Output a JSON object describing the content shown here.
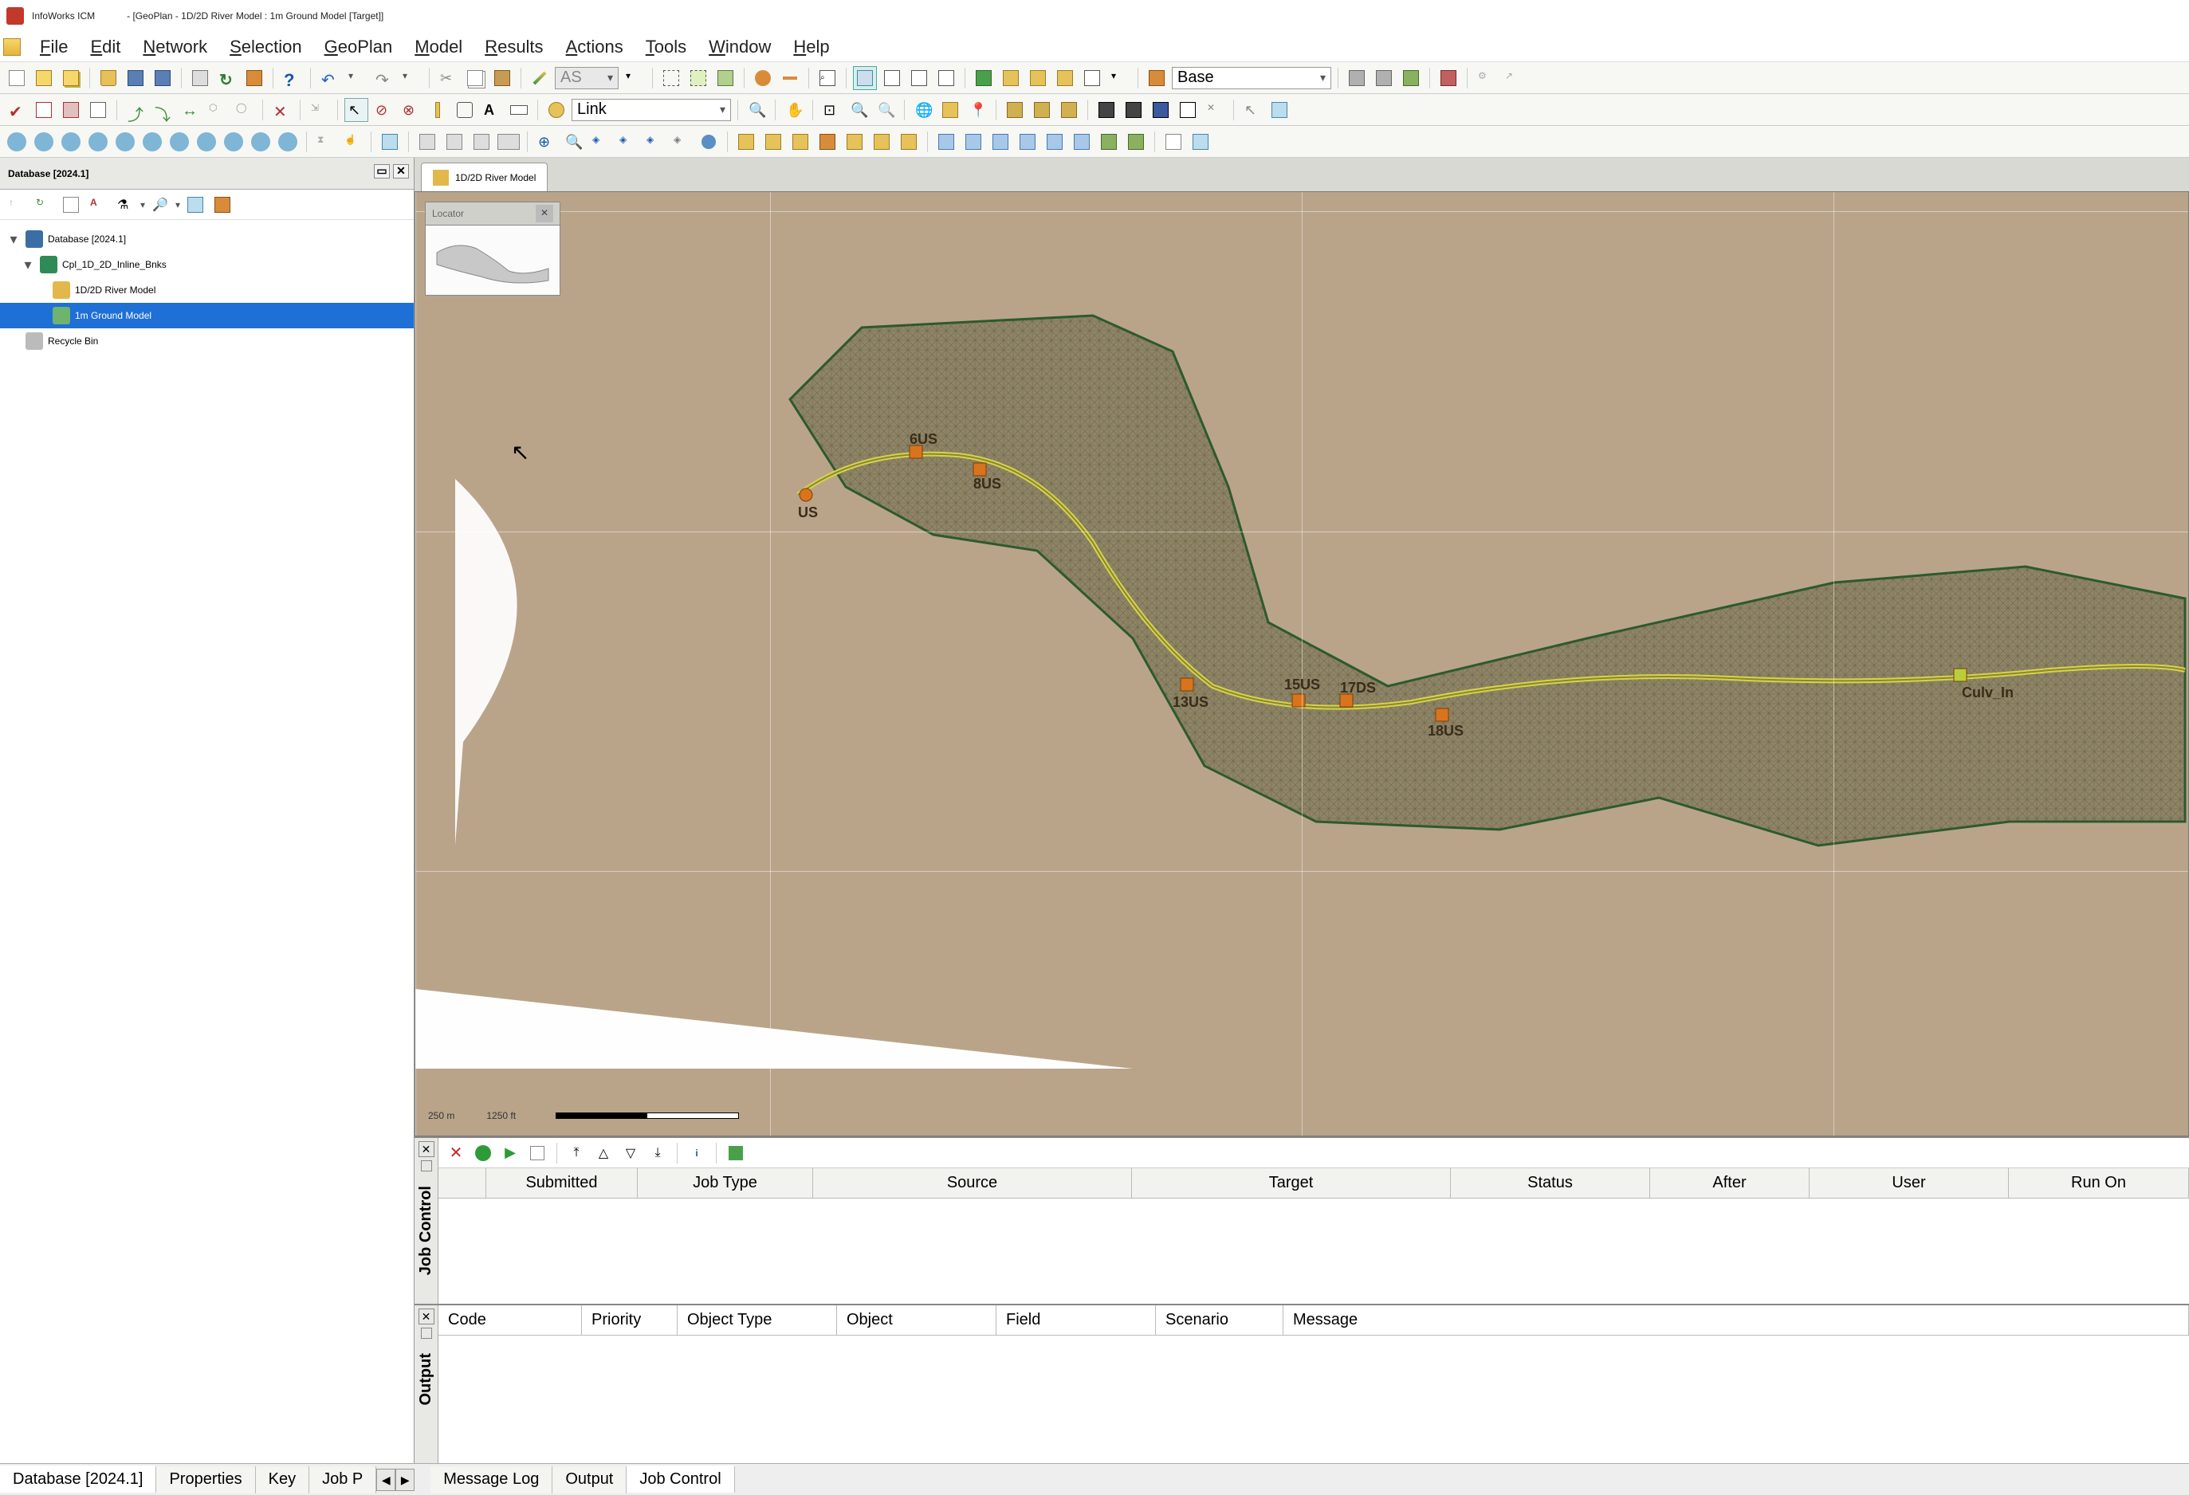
{
  "titlebar": {
    "app": "InfoWorks ICM",
    "doc": "- [GeoPlan - 1D/2D River Model : 1m Ground Model  [Target]]"
  },
  "menu": [
    "File",
    "Edit",
    "Network",
    "Selection",
    "GeoPlan",
    "Model",
    "Results",
    "Actions",
    "Tools",
    "Window",
    "Help"
  ],
  "combo_as": "AS",
  "combo_base": "Base",
  "combo_link": "Link",
  "db_panel": {
    "title": "Database [2024.1]",
    "tree": {
      "root": "Database [2024.1]",
      "group": "Cpl_1D_2D_Inline_Bnks",
      "net": "1D/2D River Model",
      "ground": "1m Ground Model",
      "bin": "Recycle Bin"
    }
  },
  "map_tab": "1D/2D River Model",
  "locator_title": "Locator",
  "scale_m": "250 m",
  "scale_ft": "1250 ft",
  "node_labels": [
    "US",
    "6US",
    "8US",
    "13US",
    "15US",
    "17DS",
    "18US",
    "Culv_In"
  ],
  "jobctrl": {
    "title": "Job Control",
    "cols": [
      "Submitted",
      "Job Type",
      "Source",
      "Target",
      "Status",
      "After",
      "User",
      "Run On"
    ]
  },
  "output": {
    "title": "Output",
    "cols": [
      "Code",
      "Priority",
      "Object Type",
      "Object",
      "Field",
      "Scenario",
      "Message"
    ]
  },
  "bottom_tabs_left": [
    "Database [2024.1]",
    "Properties",
    "Key",
    "Job P"
  ],
  "bottom_tabs_right": [
    "Message Log",
    "Output",
    "Job Control"
  ]
}
